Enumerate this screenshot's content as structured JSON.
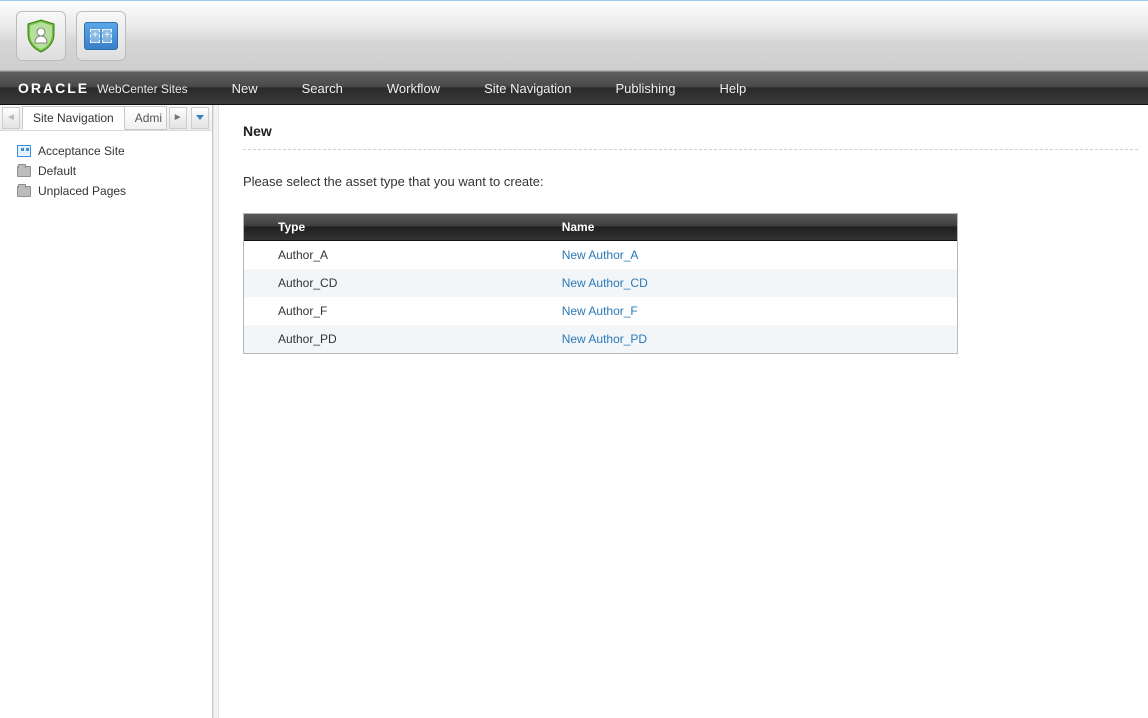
{
  "brand": {
    "oracle": "ORACLE",
    "product": "WebCenter Sites"
  },
  "nav": {
    "items": [
      "New",
      "Search",
      "Workflow",
      "Site Navigation",
      "Publishing",
      "Help"
    ]
  },
  "sidebar": {
    "tabs": {
      "active": "Site Navigation",
      "secondary": "Admi"
    },
    "tree": [
      {
        "icon": "site",
        "label": "Acceptance Site"
      },
      {
        "icon": "folder",
        "label": "Default"
      },
      {
        "icon": "folder",
        "label": "Unplaced Pages"
      }
    ]
  },
  "page": {
    "title": "New",
    "instruction": "Please select the asset type that you want to create:",
    "columns": {
      "type": "Type",
      "name": "Name"
    },
    "rows": [
      {
        "type": "Author_A",
        "name": "New Author_A"
      },
      {
        "type": "Author_CD",
        "name": "New Author_CD"
      },
      {
        "type": "Author_F",
        "name": "New Author_F"
      },
      {
        "type": "Author_PD",
        "name": "New Author_PD"
      }
    ]
  }
}
